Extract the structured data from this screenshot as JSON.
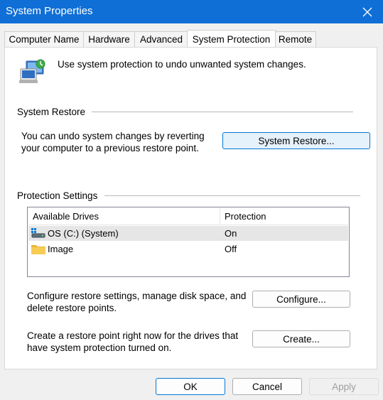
{
  "window": {
    "title": "System Properties"
  },
  "tabs": [
    {
      "label": "Computer Name"
    },
    {
      "label": "Hardware"
    },
    {
      "label": "Advanced"
    },
    {
      "label": "System Protection",
      "active": true
    },
    {
      "label": "Remote"
    }
  ],
  "intro": {
    "text": "Use system protection to undo unwanted system changes."
  },
  "system_restore": {
    "group_label": "System Restore",
    "description_line1": "You can undo system changes by reverting",
    "description_line2": "your computer to a previous restore point.",
    "button_label": "System Restore..."
  },
  "protection": {
    "group_label": "Protection Settings",
    "columns": {
      "drives": "Available Drives",
      "protection": "Protection"
    },
    "drives": [
      {
        "name": "OS (C:) (System)",
        "protection": "On",
        "icon": "system-drive-icon",
        "selected": true
      },
      {
        "name": "Image",
        "protection": "Off",
        "icon": "folder-icon"
      }
    ],
    "configure_text_line1": "Configure restore settings, manage disk space, and",
    "configure_text_line2": "delete restore points.",
    "configure_label": "Configure...",
    "create_text_line1": "Create a restore point right now for the drives that",
    "create_text_line2": "have system protection turned on.",
    "create_label": "Create..."
  },
  "footer": {
    "ok_label": "OK",
    "cancel_label": "Cancel",
    "apply_label": "Apply"
  },
  "colors": {
    "titlebar": "#0f6fd6",
    "accent": "#0078d7",
    "selection": "#e6e6e6"
  }
}
